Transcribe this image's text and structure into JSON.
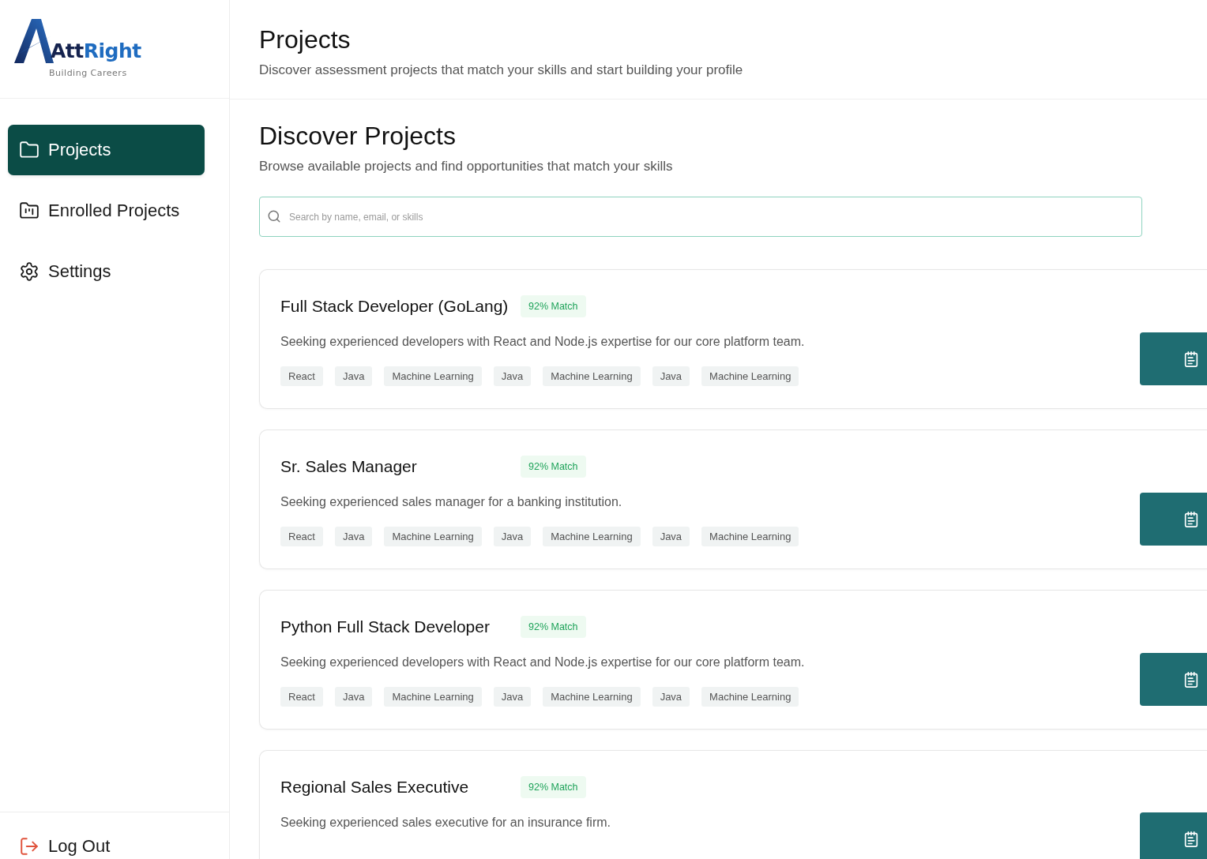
{
  "logo": {
    "name_part_1": "Att",
    "name_part_2": "Right",
    "tagline": "Building Careers"
  },
  "nav": {
    "items": [
      {
        "label": "Projects",
        "selected": true
      },
      {
        "label": "Enrolled Projects",
        "selected": false
      },
      {
        "label": "Settings",
        "selected": false
      }
    ]
  },
  "logout": {
    "label": "Log Out"
  },
  "header": {
    "title": "Projects",
    "subtitle": "Discover assessment projects that match your skills and start building your profile"
  },
  "discover": {
    "title": "Discover Projects",
    "subtitle": "Browse available projects and find opportunities that match your skills",
    "search": {
      "placeholder": "Search by name, email, or skills"
    }
  },
  "projects": [
    {
      "title": "Full Stack Developer (GoLang)",
      "match": "92% Match",
      "description": "Seeking experienced developers with React and Node.js expertise for our core platform team.",
      "tags": [
        "React",
        "Java",
        "Machine Learning",
        "Java",
        "Machine Learning",
        "Java",
        "Machine Learning"
      ]
    },
    {
      "title": "Sr. Sales Manager",
      "match": "92% Match",
      "description": "Seeking experienced sales manager for a banking institution.",
      "tags": [
        "React",
        "Java",
        "Machine Learning",
        "Java",
        "Machine Learning",
        "Java",
        "Machine Learning"
      ]
    },
    {
      "title": "Python Full Stack Developer",
      "match": "92% Match",
      "description": "Seeking experienced developers with React and Node.js expertise for our core platform team.",
      "tags": [
        "React",
        "Java",
        "Machine Learning",
        "Java",
        "Machine Learning",
        "Java",
        "Machine Learning"
      ]
    },
    {
      "title": "Regional Sales Executive",
      "match": "92% Match",
      "description": "Seeking experienced sales executive for an insurance firm."
    }
  ]
}
